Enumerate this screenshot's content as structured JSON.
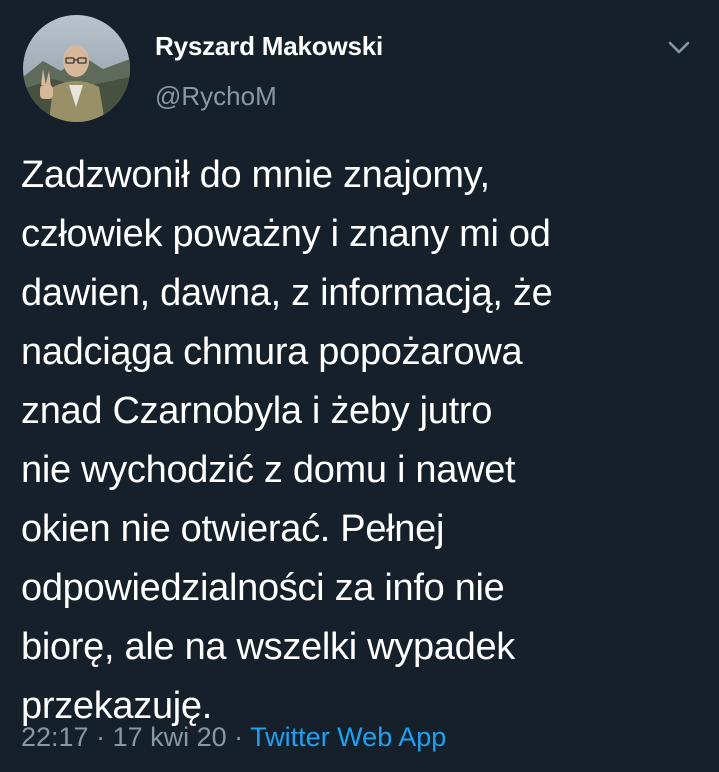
{
  "author": {
    "display_name": "Ryszard Makowski",
    "handle": "@RychoM"
  },
  "tweet": {
    "lines": [
      "Zadzwonił do mnie znajomy,",
      "człowiek poważny i znany mi od",
      "dawien, dawna, z informacją, że",
      "nadciąga chmura popożarowa",
      "znad Czarnobyla i żeby jutro",
      "nie wychodzić z domu i nawet",
      "okien nie otwierać. Pełnej",
      "odpowiedzialności za info nie",
      "biorę, ale na wszelki wypadek",
      "przekazuję."
    ]
  },
  "meta": {
    "time": "22:17",
    "separator": " · ",
    "date": "17 kwi 20",
    "source": "Twitter Web App"
  },
  "icons": {
    "menu": "chevron-down-icon",
    "avatar": "avatar"
  },
  "colors": {
    "background": "#15202b",
    "text_primary": "#ffffff",
    "text_secondary": "#8899a6",
    "link": "#1da1f2"
  }
}
